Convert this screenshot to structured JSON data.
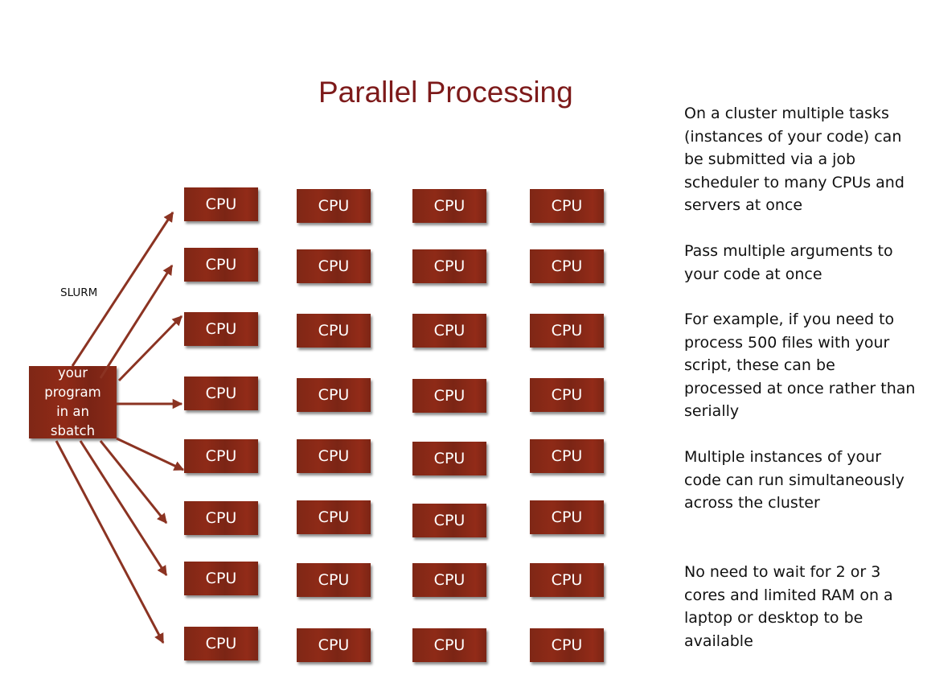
{
  "slide": {
    "title": "Parallel Processing",
    "scheduler_label": "SLURM",
    "source_box": {
      "lines": [
        "your",
        "program",
        "in an",
        "sbatch"
      ]
    },
    "cpu_grid": {
      "rows": 8,
      "columns": 4,
      "label": "CPU"
    },
    "arrows": {
      "count": 8,
      "color": "#8b3322"
    },
    "colors": {
      "title": "#7d1a1a",
      "box": "#862817",
      "box_text": "#ffffff"
    },
    "notes": [
      "On a cluster multiple tasks (instances of your code) can be submitted via a job scheduler to many CPUs and servers at once",
      "Pass multiple arguments to your code at once",
      "For example, if you need to process 500 files with your script, these can be processed at once rather than serially",
      "Multiple instances of your code can run simultaneously across the cluster",
      "No need to wait for 2 or 3 cores and limited RAM on a laptop or desktop to be available"
    ]
  }
}
